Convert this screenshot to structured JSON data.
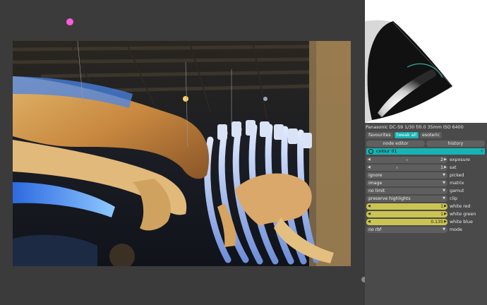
{
  "photo": {
    "title": ""
  },
  "panel": {
    "camera_info": "Panasonic DC-S9 1/30 f/0.0 35mm ISO 6400",
    "tabs": [
      {
        "label": "favourites",
        "active": false
      },
      {
        "label": "tweak all",
        "active": true
      },
      {
        "label": "esoteric",
        "active": false
      }
    ],
    "buttons": {
      "node_editor": "node editor",
      "history": "history"
    },
    "module": {
      "title": "colour 01",
      "collapse_glyph": "‹"
    },
    "sliders": {
      "exposure": {
        "label": "exposure",
        "value": "2",
        "fraction": 0.0
      },
      "sat": {
        "label": "sat",
        "value": "1",
        "fraction": 0.0
      },
      "white_red": {
        "label": "white red",
        "value": "1",
        "fraction": 1.0
      },
      "white_green": {
        "label": "white green",
        "value": "1",
        "fraction": 1.0
      },
      "white_blue": {
        "label": "white blue",
        "value": "0.135",
        "fraction": 1.0
      }
    },
    "selects": {
      "picked": {
        "label": "picked",
        "value": "ignore"
      },
      "matrix": {
        "label": "matrix",
        "value": "image"
      },
      "gamut": {
        "label": "gamut",
        "value": "no limit"
      },
      "clip": {
        "label": "clip",
        "value": "preserve highlights"
      },
      "mode": {
        "label": "mode",
        "value": "no rbf"
      }
    }
  },
  "colors": {
    "accent": "#17b3b3",
    "slider_fill": "#cbc453",
    "marker": "#ff5dd6"
  },
  "icons": {
    "power": "power-icon",
    "collapse": "chevron-left-icon",
    "left_arrow": "triangle-left-icon",
    "right_arrow": "triangle-right-icon",
    "dropdown": "triangle-down-icon"
  }
}
